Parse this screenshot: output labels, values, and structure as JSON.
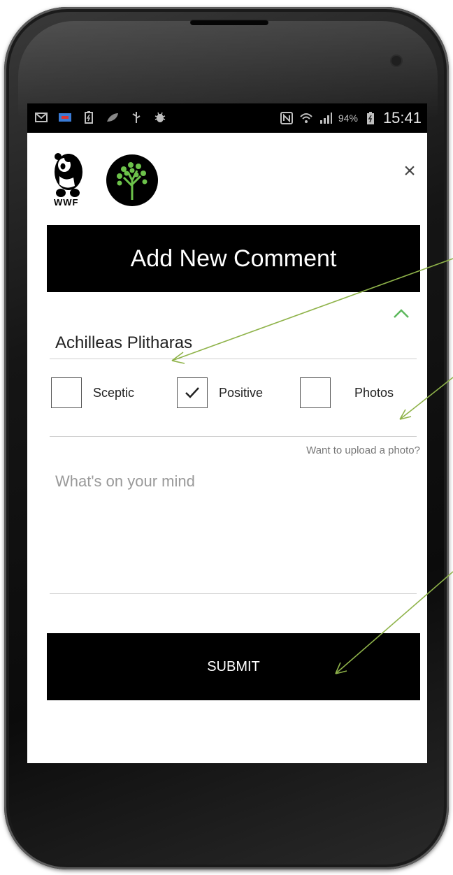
{
  "status_bar": {
    "battery_percent": "94%",
    "time": "15:41",
    "icons": [
      "gmail-icon",
      "cast-icon",
      "battery-saver-icon",
      "leaf-icon",
      "usb-icon",
      "debug-bug-icon",
      "nfc-icon",
      "wifi-icon",
      "signal-icon",
      "battery-icon"
    ]
  },
  "header": {
    "logo_text": "WWF",
    "close_label": "×"
  },
  "form": {
    "title": "Add New Comment",
    "name_value": "Achilleas Plitharas",
    "checkboxes": [
      {
        "label": "Sceptic",
        "checked": false
      },
      {
        "label": "Positive",
        "checked": true
      },
      {
        "label": "Photos",
        "checked": false
      }
    ],
    "upload_hint": "Want to upload a photo?",
    "message_placeholder": "What's on your mind",
    "submit_label": "SUBMIT"
  },
  "colors": {
    "accent_green": "#5cb85c",
    "annotation_arrow": "#8fb34a",
    "title_bar": "#000000",
    "submit_bar": "#000000"
  }
}
